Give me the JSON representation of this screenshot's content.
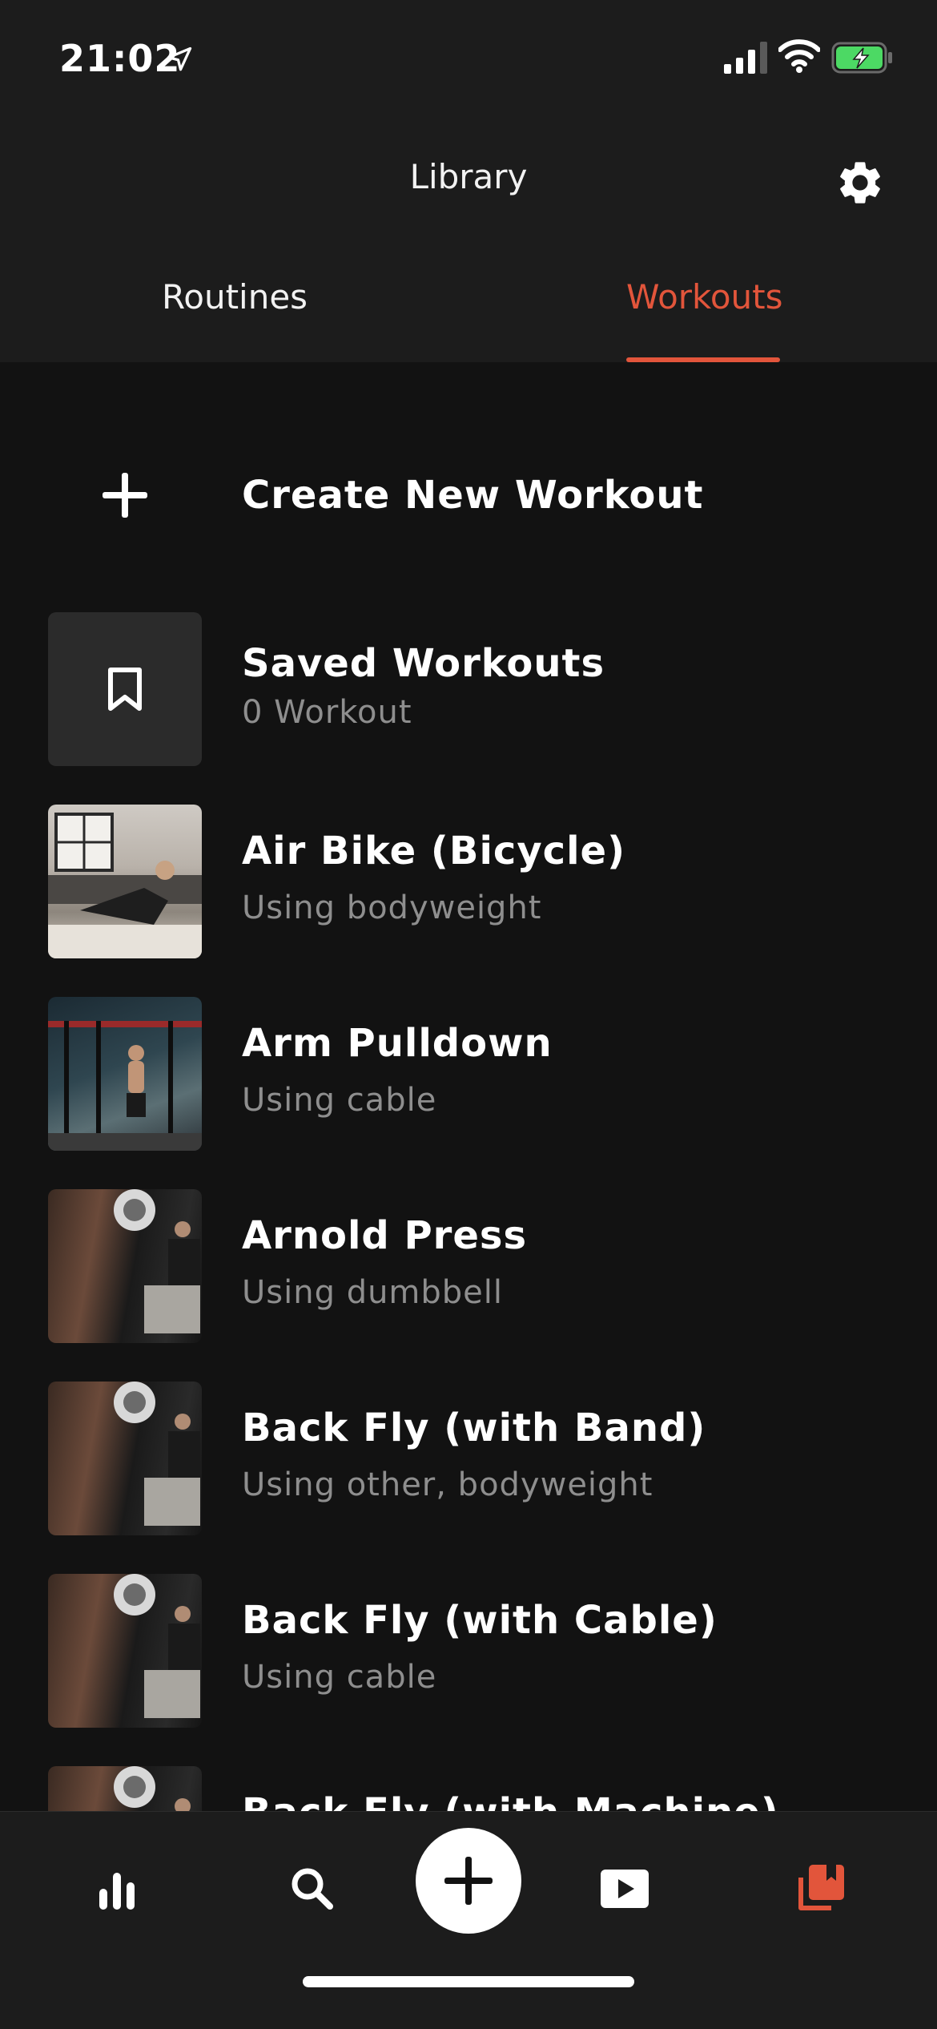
{
  "status_bar": {
    "time": "21:02"
  },
  "header": {
    "title": "Library",
    "tabs": [
      {
        "label": "Routines",
        "active": false
      },
      {
        "label": "Workouts",
        "active": true
      }
    ]
  },
  "create": {
    "label": "Create New Workout"
  },
  "saved": {
    "title": "Saved Workouts",
    "subtitle": "0 Workout"
  },
  "workouts": [
    {
      "title": "Air Bike (Bicycle)",
      "subtitle": "Using bodyweight"
    },
    {
      "title": "Arm Pulldown",
      "subtitle": "Using cable"
    },
    {
      "title": "Arnold Press",
      "subtitle": "Using dumbbell"
    },
    {
      "title": "Back Fly (with Band)",
      "subtitle": "Using other, bodyweight"
    },
    {
      "title": "Back Fly (with Cable)",
      "subtitle": "Using cable"
    },
    {
      "title": "Back Fly (with Machine)",
      "subtitle": ""
    }
  ],
  "nav": {
    "items": [
      "stats-icon",
      "search-icon",
      "add-icon",
      "video-icon",
      "library-icon"
    ],
    "active": "library-icon"
  },
  "colors": {
    "accent": "#e2553b",
    "background": "#121212",
    "header": "#1c1c1c",
    "muted_text": "#8e8e8e"
  }
}
